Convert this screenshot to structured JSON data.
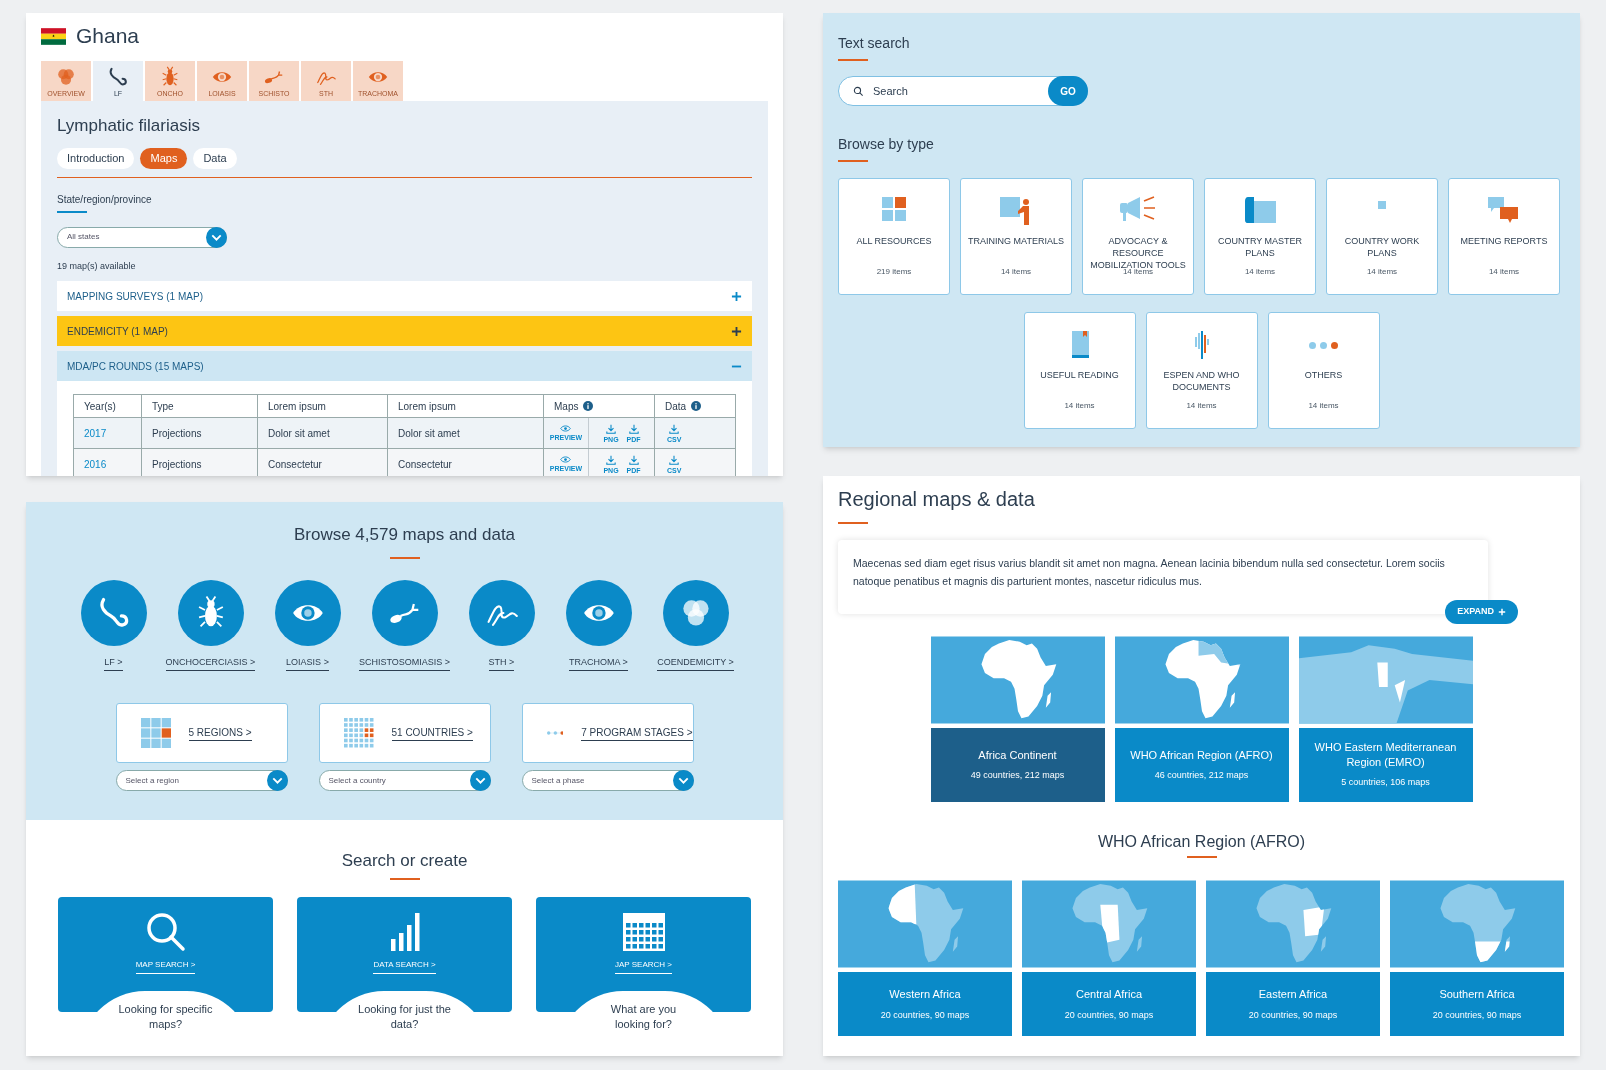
{
  "country_panel": {
    "country": "Ghana",
    "disease_tabs": [
      {
        "label": "OVERVIEW",
        "selected": false
      },
      {
        "label": "LF",
        "selected": true
      },
      {
        "label": "ONCHO",
        "selected": false
      },
      {
        "label": "LOIASIS",
        "selected": false
      },
      {
        "label": "SCHISTO",
        "selected": false
      },
      {
        "label": "STH",
        "selected": false
      },
      {
        "label": "TRACHOMA",
        "selected": false
      }
    ],
    "title": "Lymphatic filariasis",
    "view_tabs": [
      {
        "label": "Introduction",
        "selected": false
      },
      {
        "label": "Maps",
        "selected": true
      },
      {
        "label": "Data",
        "selected": false
      }
    ],
    "filter": {
      "label": "State/region/province",
      "value": "All states"
    },
    "count": "19 map(s) available",
    "sections": [
      {
        "title": "MAPPING SURVEYS (1 MAP)",
        "expanded": false,
        "highlighted": false
      },
      {
        "title": "ENDEMICITY (1 MAP)",
        "expanded": false,
        "highlighted": true
      },
      {
        "title": "MDA/PC ROUNDS (15 MAPS)",
        "expanded": true,
        "highlighted": false
      }
    ],
    "table": {
      "columns": [
        "Year(s)",
        "Type",
        "Lorem ipsum",
        "Lorem ipsum",
        "Maps",
        "Data"
      ],
      "rows": [
        {
          "year": "2017",
          "type": "Projections",
          "column_3": "Dolor sit amet",
          "column_4": "Dolor sit amet",
          "maps": [
            "PREVIEW",
            "PNG",
            "PDF"
          ],
          "data": [
            "CSV"
          ]
        },
        {
          "year": "2016",
          "type": "Projections",
          "column_3": "Consectetur",
          "column_4": "Consectetur",
          "maps": [
            "PREVIEW",
            "PNG",
            "PDF"
          ],
          "data": [
            "CSV"
          ]
        }
      ]
    }
  },
  "resources_panel": {
    "search_heading": "Text search",
    "search": {
      "placeholder": "Search",
      "button": "GO"
    },
    "browse_heading": "Browse by type",
    "types": [
      {
        "label": "ALL RESOURCES",
        "count": "219 items"
      },
      {
        "label": "TRAINING MATERIALS",
        "count": "14 items"
      },
      {
        "label": "ADVOCACY & RESOURCE MOBILIZATION TOOLS",
        "count": "14 items"
      },
      {
        "label": "COUNTRY MASTER PLANS",
        "count": "14 items"
      },
      {
        "label": "COUNTRY WORK PLANS",
        "count": "14 items"
      },
      {
        "label": "MEETING REPORTS",
        "count": "14 items"
      },
      {
        "label": "USEFUL READING",
        "count": "14 items"
      },
      {
        "label": "ESPEN AND WHO DOCUMENTS",
        "count": "14 items"
      },
      {
        "label": "OTHERS",
        "count": "14 items"
      }
    ]
  },
  "browse_panel": {
    "title": "Browse 4,579 maps and data",
    "diseases": [
      "LF >",
      "ONCHOCERCIASIS >",
      "LOIASIS >",
      "SCHISTOSOMIASIS >",
      "STH >",
      "TRACHOMA >",
      "COENDEMICITY >"
    ],
    "facets": [
      {
        "label": "5 REGIONS >",
        "placeholder": "Select a region"
      },
      {
        "label": "51 COUNTRIES >",
        "placeholder": "Select a country"
      },
      {
        "label": "7 PROGRAM STAGES >",
        "placeholder": "Select a phase"
      }
    ],
    "search_title": "Search or create",
    "search_cards": [
      {
        "link": "MAP SEARCH >",
        "caption": "Looking for specific maps?"
      },
      {
        "link": "DATA SEARCH >",
        "caption": "Looking for just the data?"
      },
      {
        "link": "JAP SEARCH >",
        "caption": "What are you looking for?"
      }
    ]
  },
  "regional_panel": {
    "title": "Regional maps & data",
    "description": "Maecenas sed diam eget risus varius blandit sit amet non magna. Aenean lacinia bibendum nulla sed consectetur. Lorem sociis natoque penatibus et magnis dis parturient montes, nascetur ridiculus mus.",
    "expand_button": "EXPAND",
    "regions": [
      {
        "name": "Africa Continent",
        "stats": "49 countries, 212 maps",
        "selected": true
      },
      {
        "name": "WHO African Region (AFRO)",
        "stats": "46 countries, 212 maps",
        "selected": false
      },
      {
        "name": "WHO Eastern Mediterranean Region (EMRO)",
        "stats": "5 countries, 106 maps",
        "selected": false
      }
    ],
    "subregion_title": "WHO African Region (AFRO)",
    "subregions": [
      {
        "name": "Western Africa",
        "stats": "20 countries, 90 maps"
      },
      {
        "name": "Central Africa",
        "stats": "20 countries, 90 maps"
      },
      {
        "name": "Eastern Africa",
        "stats": "20 countries, 90 maps"
      },
      {
        "name": "Southern Africa",
        "stats": "20 countries, 90 maps"
      }
    ]
  }
}
